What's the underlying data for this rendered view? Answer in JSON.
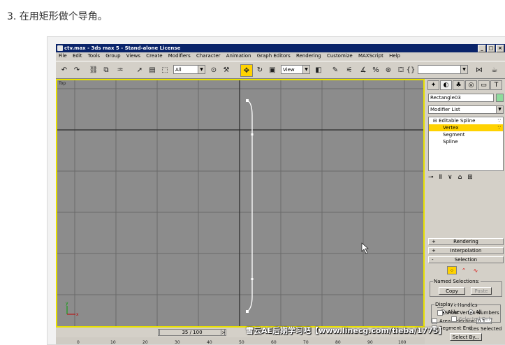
{
  "step_text": "3. 在用矩形做个导角。",
  "window": {
    "title": "ctv.max - 3ds max 5 - Stand-alone License",
    "controls": [
      "_",
      "□",
      "×"
    ]
  },
  "menu": [
    "File",
    "Edit",
    "Tools",
    "Group",
    "Views",
    "Create",
    "Modifiers",
    "Character",
    "Animation",
    "Graph Editors",
    "Rendering",
    "Customize",
    "MAXScript",
    "Help"
  ],
  "toolbar": {
    "selection_filter": "All",
    "reference_coord": "View"
  },
  "viewport": {
    "label": "Top"
  },
  "command_panel": {
    "object_name": "Rectangle03",
    "swatch_color": "#8edb9c",
    "modifier_list": "Modifier List",
    "stack": [
      {
        "label": "Editable Spline",
        "selected": false
      },
      {
        "label": "Vertex",
        "selected": true
      },
      {
        "label": "Segment",
        "selected": false
      },
      {
        "label": "Spline",
        "selected": false
      }
    ],
    "rollouts": {
      "rendering": "Rendering",
      "interpolation": "Interpolation",
      "selection": "Selection"
    },
    "named_selections": {
      "label": "Named Selections:",
      "copy": "Copy",
      "paste": "Paste"
    },
    "lock_handles": "Lock Handles",
    "alike": "Alike",
    "all": "All",
    "area_selection": "Area Selection:",
    "area_value": "0.1",
    "segment_end": "Segment End",
    "select_by": "Select By...",
    "display": {
      "label": "Display",
      "show_vertex_numbers": "Show Vertex Numbers",
      "selected_only": "Selected Only"
    },
    "status": "ices Selected"
  },
  "timeline": {
    "frame": "35 / 100",
    "ticks": [
      "0",
      "10",
      "20",
      "30",
      "40",
      "50",
      "60",
      "70",
      "80",
      "90",
      "100"
    ]
  },
  "watermark": "雪云AE后期学习吧【www.linecg.com/tieba/1775】",
  "colors": {
    "title_bar": "#0a246a",
    "active_yellow": "#ffd200",
    "viewport_bg": "#8c8c8c",
    "viewport_border": "#e8e000"
  }
}
